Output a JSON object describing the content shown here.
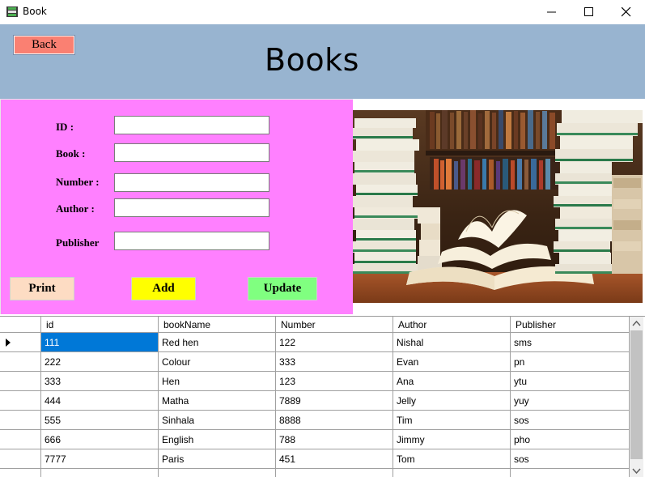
{
  "window": {
    "title": "Book"
  },
  "header": {
    "back_label": "Back",
    "page_title": "Books"
  },
  "form": {
    "fields": [
      {
        "label": "ID :",
        "value": ""
      },
      {
        "label": "Book  :",
        "value": ""
      },
      {
        "label": "Number :",
        "value": ""
      },
      {
        "label": "Author :",
        "value": ""
      },
      {
        "label": "Publisher",
        "value": ""
      }
    ],
    "buttons": {
      "print": "Print",
      "add": "Add",
      "update": "Update"
    }
  },
  "colors": {
    "header_bg": "#98b4d0",
    "form_bg": "#ff80ff",
    "back_button": "#fa8072",
    "print_button": "#fddcc3",
    "add_button": "#ffff00",
    "update_button": "#80ff80",
    "selection": "#0078d7"
  },
  "grid": {
    "columns": [
      "id",
      "bookName",
      "Number",
      "Author",
      "Publisher"
    ],
    "rows": [
      [
        "111",
        "Red hen",
        "122",
        "Nishal",
        "sms"
      ],
      [
        "222",
        "Colour",
        "333",
        "Evan",
        "pn"
      ],
      [
        "333",
        "Hen",
        "123",
        "Ana",
        "ytu"
      ],
      [
        "444",
        "Matha",
        "7889",
        "Jelly",
        "yuy"
      ],
      [
        "555",
        "Sinhala",
        "8888",
        "Tim",
        "sos"
      ],
      [
        "666",
        "English",
        "788",
        "Jimmy",
        "pho"
      ],
      [
        "7777",
        "Paris",
        "451",
        "Tom",
        "sos"
      ]
    ],
    "selected_row": 0
  },
  "icons": {
    "window_icon": "book-stack-icon",
    "row_indicator": "current-row-arrow-icon"
  }
}
